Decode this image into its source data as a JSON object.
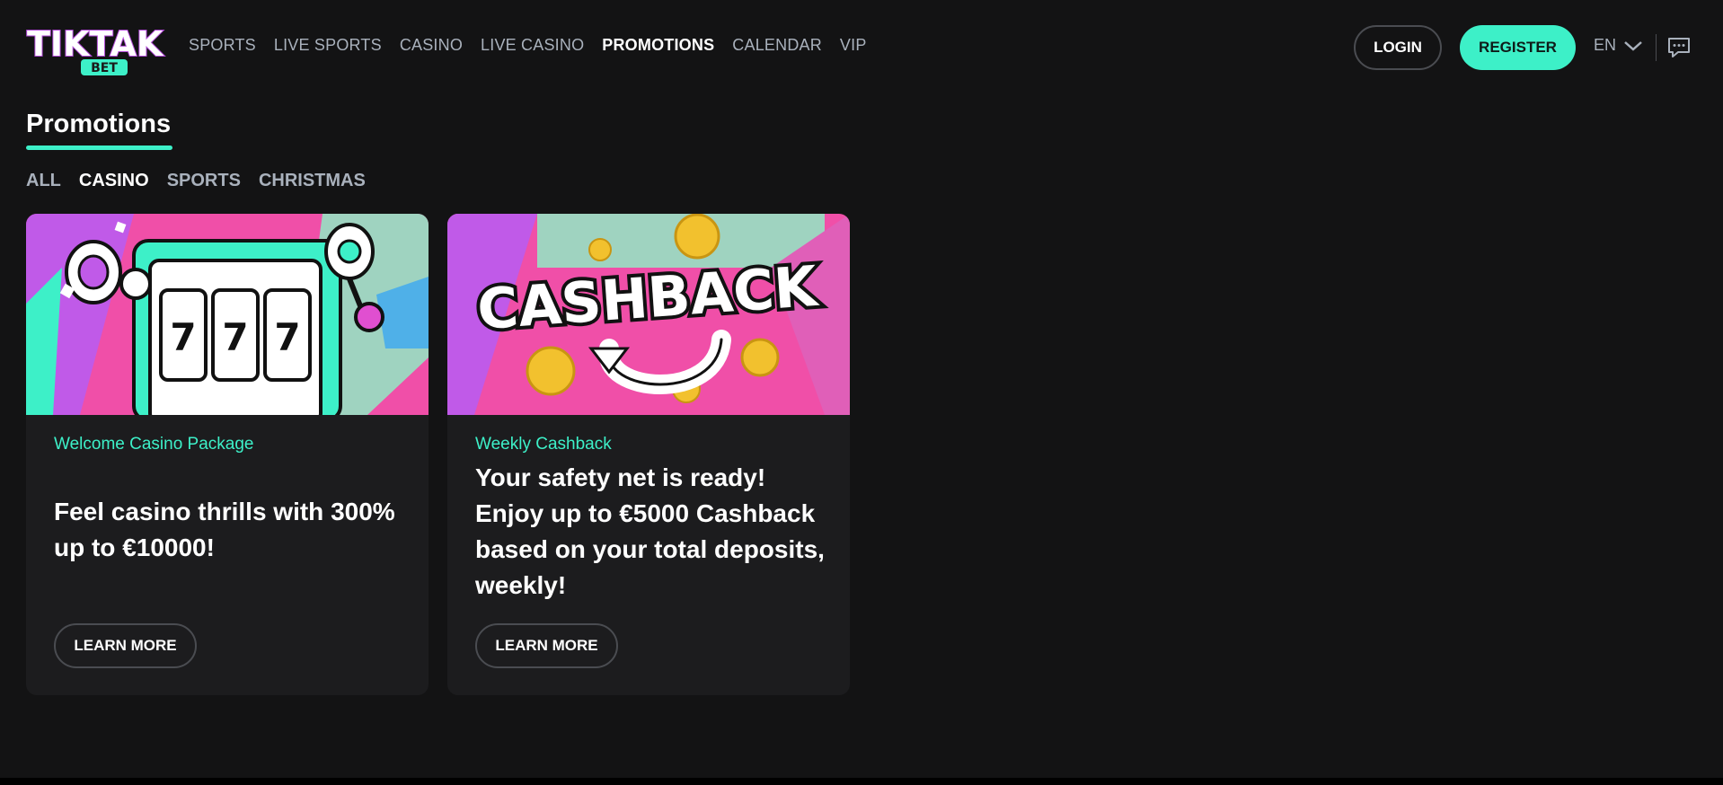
{
  "brand": {
    "logo_text_top": "TIKTAK",
    "logo_text_bottom": "BET",
    "accent_color": "#3df0c8",
    "pink_color": "#f04fa8"
  },
  "nav": {
    "items": [
      {
        "label": "SPORTS",
        "active": false
      },
      {
        "label": "LIVE SPORTS",
        "active": false
      },
      {
        "label": "CASINO",
        "active": false
      },
      {
        "label": "LIVE CASINO",
        "active": false
      },
      {
        "label": "PROMOTIONS",
        "active": true
      },
      {
        "label": "CALENDAR",
        "active": false
      },
      {
        "label": "VIP",
        "active": false
      }
    ]
  },
  "header": {
    "login_label": "LOGIN",
    "register_label": "REGISTER",
    "language": "EN",
    "chat_icon": "chat-icon"
  },
  "main": {
    "title": "Promotions",
    "filters": [
      {
        "label": "ALL",
        "active": false
      },
      {
        "label": "CASINO",
        "active": true
      },
      {
        "label": "SPORTS",
        "active": false
      },
      {
        "label": "CHRISTMAS",
        "active": false
      }
    ],
    "cards": [
      {
        "image": "slot-machine-image",
        "subtitle": "Welcome Casino Package",
        "text": "Feel casino thrills with 300% up to €10000!",
        "button": "LEARN MORE"
      },
      {
        "image": "cashback-image",
        "image_text": "CASHBACK",
        "subtitle": "Weekly Cashback",
        "text": "Your safety net is ready! Enjoy up to €5000 Cashback based on your total deposits, weekly!",
        "button": "LEARN MORE"
      }
    ]
  }
}
